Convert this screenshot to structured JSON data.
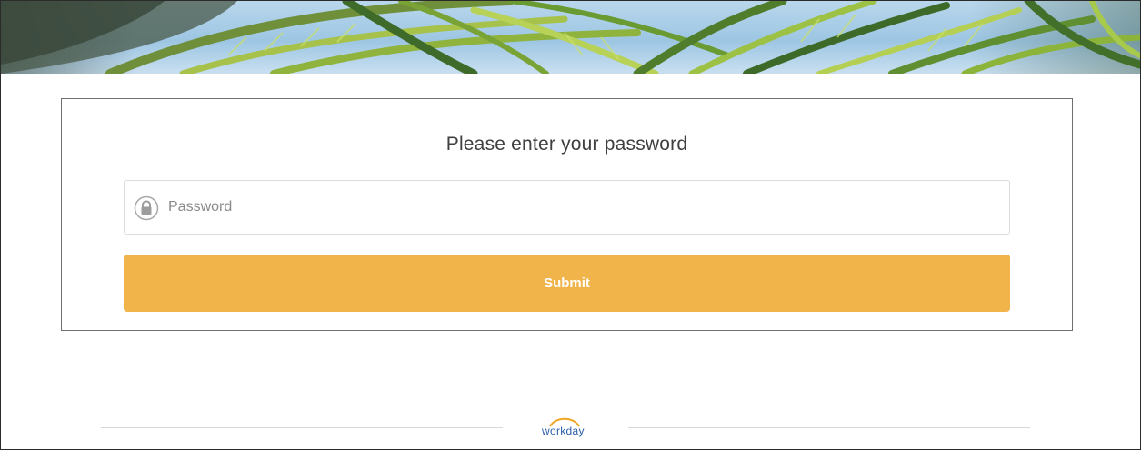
{
  "login": {
    "title": "Please enter your password",
    "password_placeholder": "Password",
    "password_value": "",
    "submit_label": "Submit"
  },
  "footer": {
    "logo_text": "workday"
  },
  "icons": {
    "field_icon": "lock-icon",
    "logo_mark": "workday-logo-arc"
  },
  "colors": {
    "submit_bg": "#f0b44a",
    "submit_text": "#ffffff",
    "logo_blue": "#2a5ea8",
    "logo_arc": "#f0a623"
  }
}
